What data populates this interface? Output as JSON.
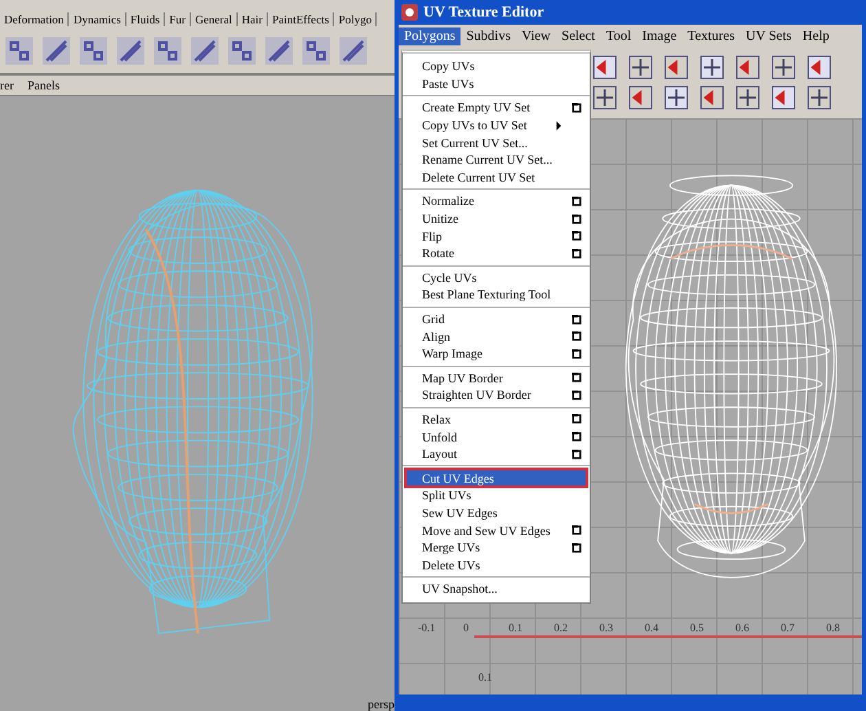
{
  "shelf_tabs": [
    {
      "label": "Deformation"
    },
    {
      "label": "Dynamics"
    },
    {
      "label": "Fluids"
    },
    {
      "label": "Fur"
    },
    {
      "label": "General"
    },
    {
      "label": "Hair"
    },
    {
      "label": "PaintEffects"
    },
    {
      "label": "Polygo"
    }
  ],
  "panel_menu": [
    "rer",
    "Panels"
  ],
  "viewport": {
    "camera_label": "persp"
  },
  "window": {
    "title": "UV Texture Editor"
  },
  "menu_bar": [
    {
      "label": "Polygons",
      "selected": true
    },
    {
      "label": "Subdivs",
      "selected": false
    },
    {
      "label": "View",
      "selected": false
    },
    {
      "label": "Select",
      "selected": false
    },
    {
      "label": "Tool",
      "selected": false
    },
    {
      "label": "Image",
      "selected": false
    },
    {
      "label": "Textures",
      "selected": false
    },
    {
      "label": "UV Sets",
      "selected": false
    },
    {
      "label": "Help",
      "selected": false
    }
  ],
  "menu_groups": [
    [
      {
        "label": "Copy UVs",
        "kind": "plain",
        "selected": false
      },
      {
        "label": "Paste UVs",
        "kind": "plain",
        "selected": false
      }
    ],
    [
      {
        "label": "Create Empty UV Set",
        "kind": "option",
        "selected": false
      },
      {
        "label": "Copy UVs to UV Set",
        "kind": "submenu",
        "selected": false
      },
      {
        "label": "Set Current UV Set...",
        "kind": "plain",
        "selected": false
      },
      {
        "label": "Rename Current UV Set...",
        "kind": "plain",
        "selected": false
      },
      {
        "label": "Delete Current UV Set",
        "kind": "plain",
        "selected": false
      }
    ],
    [
      {
        "label": "Normalize",
        "kind": "option",
        "selected": false
      },
      {
        "label": "Unitize",
        "kind": "option",
        "selected": false
      },
      {
        "label": "Flip",
        "kind": "option",
        "selected": false
      },
      {
        "label": "Rotate",
        "kind": "option",
        "selected": false
      }
    ],
    [
      {
        "label": "Cycle UVs",
        "kind": "plain",
        "selected": false
      },
      {
        "label": "Best Plane Texturing Tool",
        "kind": "plain",
        "selected": false
      }
    ],
    [
      {
        "label": "Grid",
        "kind": "option",
        "selected": false
      },
      {
        "label": "Align",
        "kind": "option",
        "selected": false
      },
      {
        "label": "Warp Image",
        "kind": "option",
        "selected": false
      }
    ],
    [
      {
        "label": "Map UV Border",
        "kind": "option",
        "selected": false
      },
      {
        "label": "Straighten UV Border",
        "kind": "option",
        "selected": false
      }
    ],
    [
      {
        "label": "Relax",
        "kind": "option",
        "selected": false
      },
      {
        "label": "Unfold",
        "kind": "option",
        "selected": false
      },
      {
        "label": "Layout",
        "kind": "option",
        "selected": false
      }
    ],
    [
      {
        "label": "Cut UV Edges",
        "kind": "plain",
        "selected": true
      },
      {
        "label": "Split UVs",
        "kind": "plain",
        "selected": false
      },
      {
        "label": "Sew UV Edges",
        "kind": "plain",
        "selected": false
      },
      {
        "label": "Move and Sew UV Edges",
        "kind": "option",
        "selected": false
      },
      {
        "label": "Merge UVs",
        "kind": "option",
        "selected": false
      },
      {
        "label": "Delete UVs",
        "kind": "plain",
        "selected": false
      }
    ],
    [
      {
        "label": "UV Snapshot...",
        "kind": "plain",
        "selected": false
      }
    ]
  ],
  "uv_grid": {
    "u_labels": [
      "-0.1",
      "0",
      "0.1",
      "0.2",
      "0.3",
      "0.4",
      "0.5",
      "0.6",
      "0.7",
      "0.8"
    ],
    "v_labels": [
      "0.1"
    ]
  }
}
